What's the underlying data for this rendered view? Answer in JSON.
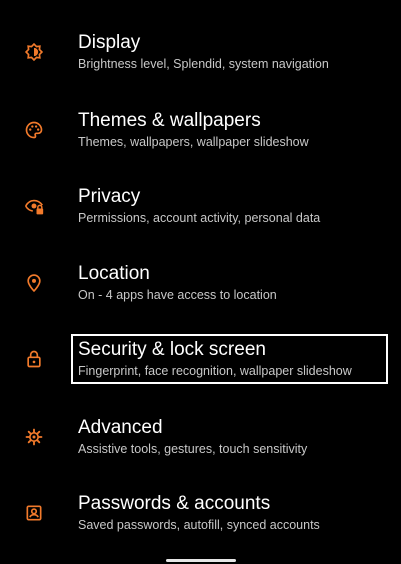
{
  "accent_color": "#f27a2b",
  "settings": {
    "items": [
      {
        "icon": "display-brightness-icon",
        "title": "Display",
        "summary": "Brightness level, Splendid, system navigation"
      },
      {
        "icon": "palette-icon",
        "title": "Themes & wallpapers",
        "summary": "Themes, wallpapers, wallpaper slideshow"
      },
      {
        "icon": "privacy-eye-lock-icon",
        "title": "Privacy",
        "summary": "Permissions, account activity, personal data"
      },
      {
        "icon": "location-pin-icon",
        "title": "Location",
        "summary": "On - 4 apps have access to location"
      },
      {
        "icon": "lock-icon",
        "title": "Security & lock screen",
        "summary": "Fingerprint, face recognition, wallpaper slideshow"
      },
      {
        "icon": "gear-icon",
        "title": "Advanced",
        "summary": "Assistive tools, gestures, touch sensitivity"
      },
      {
        "icon": "account-box-icon",
        "title": "Passwords & accounts",
        "summary": "Saved passwords, autofill, synced accounts"
      }
    ]
  }
}
